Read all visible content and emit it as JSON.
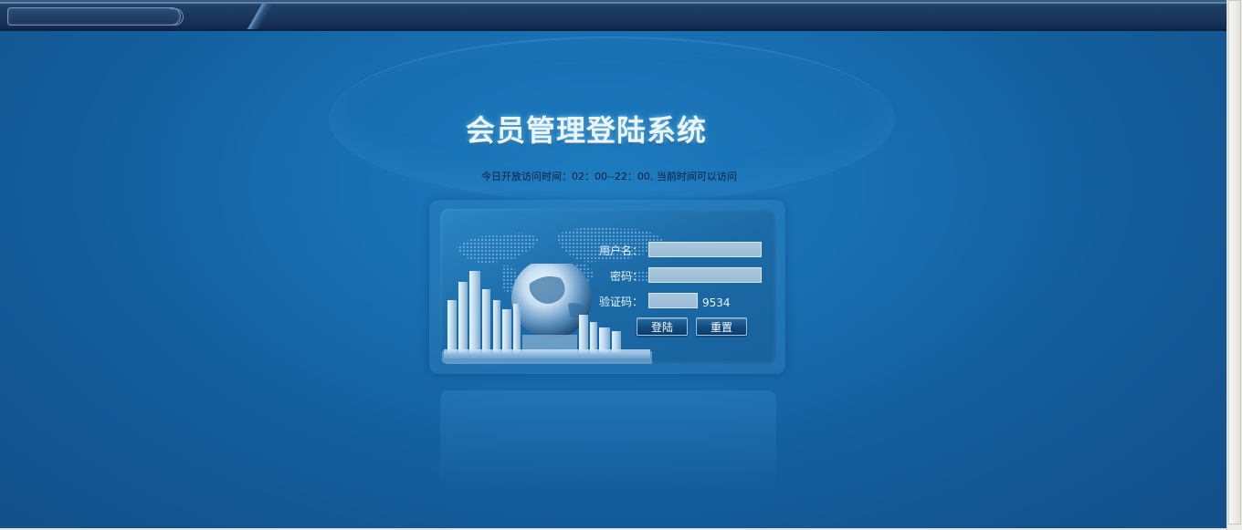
{
  "header": {
    "title": "会员管理登陆系统",
    "notice": "今日开放访问时间：02：00--22：00, 当前时间可以访问"
  },
  "login": {
    "username_label": "用户名：",
    "password_label": "密码：",
    "captcha_label": "验证码：",
    "username_value": "",
    "password_value": "",
    "captcha_input_value": "",
    "captcha_code": "9534",
    "login_button": "登陆",
    "reset_button": "重置"
  },
  "colors": {
    "background": "#1870b2",
    "panel": "#1b6aa6",
    "input": "#a9c6dd",
    "title_text": "#eaf6ff"
  }
}
